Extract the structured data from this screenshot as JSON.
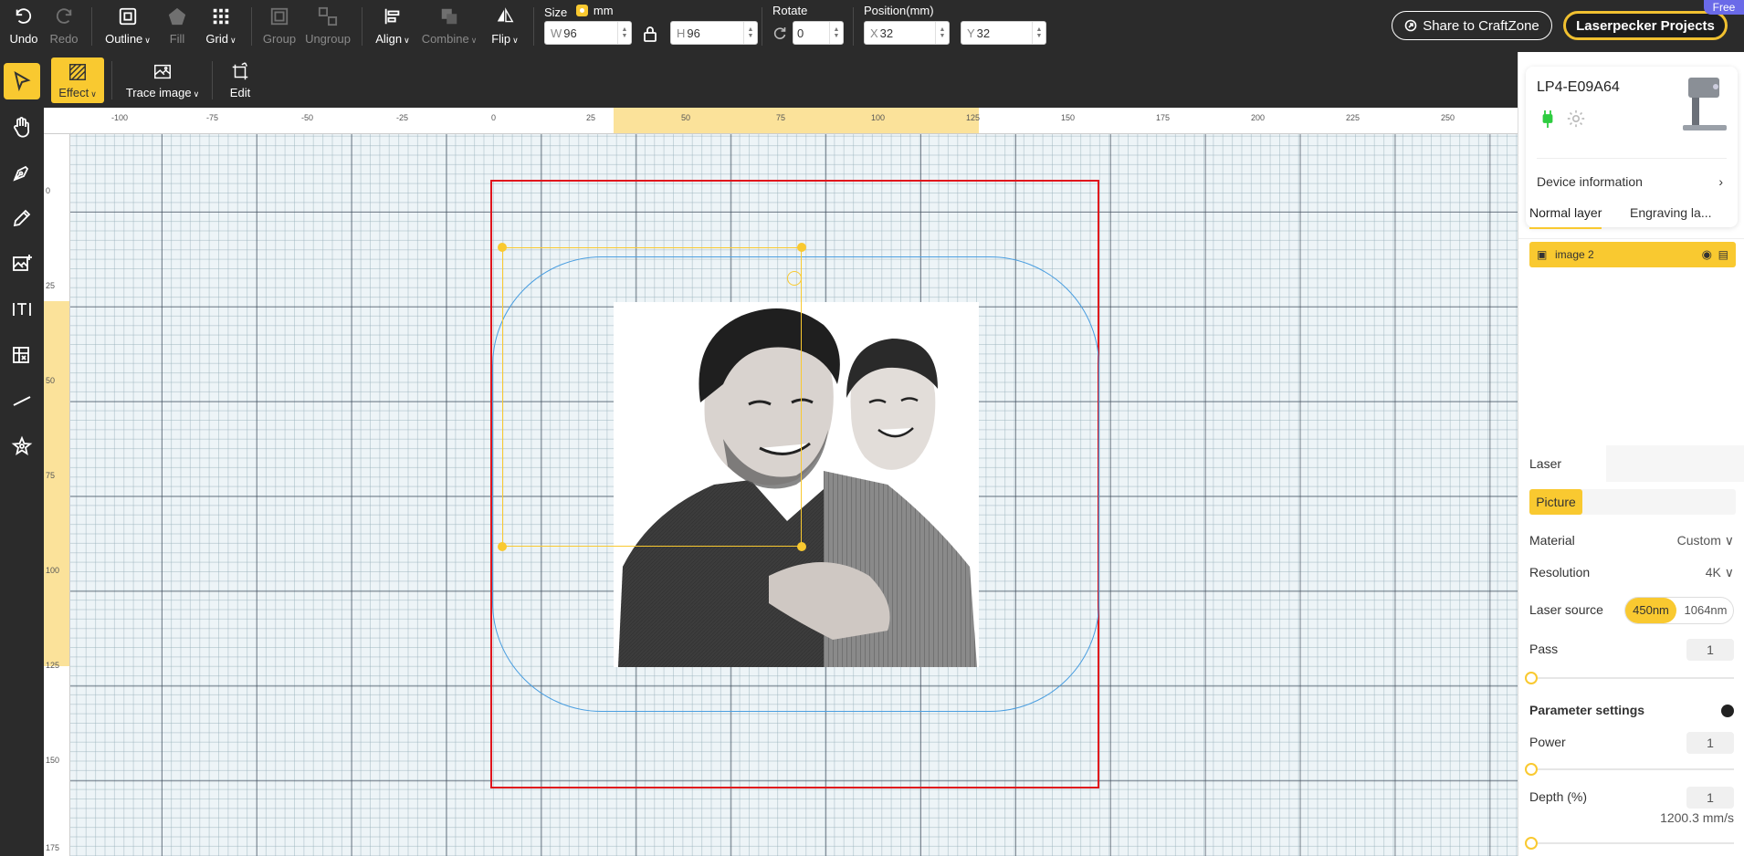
{
  "toolbar": {
    "undo": "Undo",
    "redo": "Redo",
    "outline": "Outline",
    "fill": "Fill",
    "grid": "Grid",
    "group": "Group",
    "ungroup": "Ungroup",
    "align": "Align",
    "combine": "Combine",
    "flip": "Flip",
    "size_label": "Size",
    "unit": "mm",
    "w_prefix": "W",
    "w_value": "96",
    "h_prefix": "H",
    "h_value": "96",
    "rotate_label": "Rotate",
    "rotate_value": "0",
    "position_label": "Position(mm)",
    "x_prefix": "X",
    "x_value": "32",
    "y_prefix": "Y",
    "y_value": "32",
    "share": "Share to CraftZone",
    "projects": "Laserpecker Projects",
    "free_badge": "Free"
  },
  "subtoolbar": {
    "effect": "Effect",
    "trace": "Trace image",
    "edit": "Edit"
  },
  "left_tools": [
    "select-tool-icon",
    "hand-tool-icon",
    "pen-tool-icon",
    "pencil-tool-icon",
    "add-image-icon",
    "text-tool-icon",
    "table-tool-icon",
    "line-tool-icon",
    "shape-tool-icon"
  ],
  "rulers": {
    "x_ticks": [
      "-100",
      "-75",
      "-50",
      "-25",
      "0",
      "25",
      "50",
      "75",
      "100",
      "125",
      "150",
      "175",
      "200",
      "225",
      "250"
    ],
    "y_ticks": [
      "0",
      "25",
      "50",
      "75",
      "100",
      "125",
      "150",
      "175"
    ]
  },
  "canvas": {
    "image_alt": "Father and son portrait"
  },
  "panel": {
    "device_name": "LP4-E09A64",
    "device_info": "Device information",
    "tabs": [
      "Normal layer",
      "Engraving la..."
    ],
    "layer_name": "image 2",
    "section": "Laser engra...",
    "mode": "Picture",
    "material_label": "Material",
    "material_value": "Custom",
    "resolution_label": "Resolution",
    "resolution_value": "4K",
    "laser_label": "Laser source",
    "laser_opt1": "450nm",
    "laser_opt2": "1064nm",
    "pass_label": "Pass",
    "pass_value": "1",
    "params_title": "Parameter settings",
    "power_label": "Power",
    "power_value": "1",
    "depth_label": "Depth (%)",
    "depth_value": "1",
    "speed_text": "1200.3 mm/s"
  },
  "colors": {
    "accent": "#f9c930",
    "toolbar_bg": "#2b2b2b",
    "work_area": "#e0141c",
    "outline": "#4a9ee0"
  }
}
